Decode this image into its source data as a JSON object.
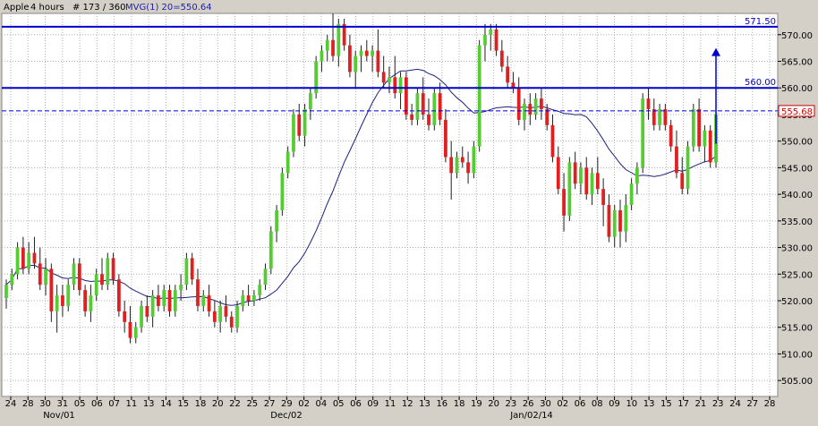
{
  "header": {
    "symbol": "Apple",
    "timeframe": "4 hours",
    "bar_info": "# 173 / 360",
    "indicator": "MVG(1) 20=550.64"
  },
  "colors": {
    "background": "#ffffff",
    "frame": "#d4d0c8",
    "grid": "#b0b0b0",
    "up_candle": "#55cc33",
    "down_candle": "#e02020",
    "wick": "#202020",
    "moving_average": "#1a237e",
    "resistance_line": "#0000cc",
    "price_marker": "#cc0000",
    "header_text": "#000000",
    "indicator_text": "#2020aa"
  },
  "chart_data": {
    "type": "candlestick",
    "ylim": [
      502,
      574
    ],
    "y_ticks": [
      505,
      510,
      515,
      520,
      525,
      530,
      535,
      540,
      545,
      550,
      555,
      560,
      565,
      570
    ],
    "y_tick_labels": [
      "505.00",
      "510.00",
      "515.00",
      "520.00",
      "525.00",
      "530.00",
      "535.00",
      "540.00",
      "545.00",
      "550.00",
      "555.00",
      "560.00",
      "565.00",
      "570.00"
    ],
    "x_tick_labels": [
      "24",
      "28",
      "30",
      "31",
      "05",
      "06",
      "07",
      "11",
      "13",
      "14",
      "15",
      "18",
      "20",
      "22",
      "25",
      "27",
      "29",
      "02",
      "04",
      "05",
      "06",
      "09",
      "11",
      "12",
      "13",
      "16",
      "18",
      "19",
      "20",
      "23",
      "26",
      "30",
      "02",
      "06",
      "08",
      "09",
      "10",
      "13",
      "15",
      "17",
      "21",
      "23",
      "24",
      "27",
      "28"
    ],
    "x_month_labels": [
      "Nov/01",
      "Dec/02",
      "Jan/02/14"
    ],
    "horizontal_lines": [
      {
        "label": "571.50",
        "value": 571.5
      },
      {
        "label": "560.00",
        "value": 560.0
      }
    ],
    "current_price": {
      "label": "555.68",
      "value": 555.68
    },
    "moving_average_label": "MVG(1) 20=550.64",
    "target_arrow": {
      "from": 549.5,
      "to": 567.5
    },
    "ohlc": [
      [
        520.5,
        524,
        518.5,
        523
      ],
      [
        523,
        526,
        522,
        525
      ],
      [
        525,
        531,
        524,
        530
      ],
      [
        530,
        532,
        525,
        526
      ],
      [
        526,
        531,
        525,
        529
      ],
      [
        529,
        532,
        526,
        527
      ],
      [
        527,
        530,
        522,
        523
      ],
      [
        523,
        528,
        521,
        526
      ],
      [
        526,
        527,
        516,
        518
      ],
      [
        518,
        523,
        514,
        521
      ],
      [
        521,
        523,
        517,
        519
      ],
      [
        519,
        524,
        518,
        523
      ],
      [
        523,
        528,
        522,
        527
      ],
      [
        527,
        528,
        521,
        522
      ],
      [
        522,
        523,
        517,
        518
      ],
      [
        518,
        523,
        516,
        521
      ],
      [
        521,
        526,
        520,
        525
      ],
      [
        525,
        528,
        522,
        523
      ],
      [
        523,
        529,
        522,
        528
      ],
      [
        528,
        529,
        523,
        524
      ],
      [
        524,
        525,
        517,
        518
      ],
      [
        518,
        520,
        514,
        516
      ],
      [
        516,
        519,
        512,
        513
      ],
      [
        513,
        516,
        512,
        515
      ],
      [
        515,
        520,
        514,
        519
      ],
      [
        519,
        521,
        516,
        517
      ],
      [
        517,
        522,
        515,
        521
      ],
      [
        521,
        523,
        518,
        519
      ],
      [
        519,
        523,
        518,
        522
      ],
      [
        522,
        523,
        517,
        518
      ],
      [
        518,
        523,
        517,
        522
      ],
      [
        522,
        525,
        520,
        523
      ],
      [
        523,
        529,
        522,
        528
      ],
      [
        528,
        529,
        523,
        524
      ],
      [
        524,
        526,
        518,
        519
      ],
      [
        519,
        522,
        518,
        521
      ],
      [
        521,
        523,
        517,
        518
      ],
      [
        518,
        520,
        515,
        516
      ],
      [
        516,
        520,
        514,
        519
      ],
      [
        519,
        521,
        516,
        517
      ],
      [
        517,
        518,
        514,
        515
      ],
      [
        515,
        520,
        514,
        519
      ],
      [
        519,
        522,
        518,
        521
      ],
      [
        521,
        523,
        519,
        520
      ],
      [
        520,
        522,
        519,
        521
      ],
      [
        521,
        524,
        520,
        523
      ],
      [
        523,
        527,
        522,
        526
      ],
      [
        526,
        534,
        525,
        533
      ],
      [
        533,
        538,
        531,
        537
      ],
      [
        537,
        545,
        536,
        544
      ],
      [
        544,
        549,
        543,
        548
      ],
      [
        548,
        556,
        547,
        555
      ],
      [
        555,
        557,
        550,
        551
      ],
      [
        551,
        557,
        549,
        556
      ],
      [
        556,
        560,
        554,
        559
      ],
      [
        559,
        566,
        558,
        565
      ],
      [
        565,
        568,
        563,
        567
      ],
      [
        567,
        570,
        565,
        569
      ],
      [
        569,
        574,
        565,
        566
      ],
      [
        566,
        573,
        564,
        572
      ],
      [
        572,
        573,
        567,
        568
      ],
      [
        568,
        570,
        562,
        563
      ],
      [
        563,
        567,
        560,
        566
      ],
      [
        566,
        568,
        563,
        567
      ],
      [
        567,
        569,
        565,
        566
      ],
      [
        566,
        568,
        563,
        567
      ],
      [
        567,
        571,
        562,
        563
      ],
      [
        563,
        566,
        560,
        561
      ],
      [
        561,
        564,
        559,
        562
      ],
      [
        562,
        566,
        558,
        559
      ],
      [
        559,
        563,
        556,
        562
      ],
      [
        562,
        563,
        554,
        555
      ],
      [
        555,
        557,
        553,
        554
      ],
      [
        554,
        560,
        553,
        559
      ],
      [
        559,
        562,
        554,
        555
      ],
      [
        555,
        558,
        552,
        553
      ],
      [
        553,
        560,
        552,
        559
      ],
      [
        559,
        561,
        553,
        554
      ],
      [
        554,
        556,
        546,
        547
      ],
      [
        547,
        550,
        539,
        544
      ],
      [
        544,
        548,
        543,
        547
      ],
      [
        547,
        549,
        545,
        546
      ],
      [
        546,
        548,
        542,
        544
      ],
      [
        544,
        550,
        543,
        549
      ],
      [
        549,
        569,
        548,
        568
      ],
      [
        568,
        572,
        565,
        570
      ],
      [
        570,
        572,
        567,
        571
      ],
      [
        571,
        572,
        566,
        567
      ],
      [
        567,
        569,
        563,
        564
      ],
      [
        564,
        566,
        560,
        561
      ],
      [
        561,
        563,
        559,
        560
      ],
      [
        560,
        562,
        553,
        554
      ],
      [
        554,
        558,
        552,
        557
      ],
      [
        557,
        559,
        553,
        555
      ],
      [
        555,
        559,
        554,
        558
      ],
      [
        558,
        560,
        554,
        556
      ],
      [
        556,
        557,
        552,
        553
      ],
      [
        553,
        555,
        546,
        547
      ],
      [
        547,
        549,
        540,
        541
      ],
      [
        541,
        544,
        533,
        536
      ],
      [
        536,
        547,
        535,
        546
      ],
      [
        546,
        548,
        541,
        542
      ],
      [
        542,
        546,
        540,
        545
      ],
      [
        545,
        547,
        539,
        540
      ],
      [
        540,
        545,
        538,
        544
      ],
      [
        544,
        547,
        540,
        541
      ],
      [
        541,
        543,
        534,
        538
      ],
      [
        538,
        540,
        531,
        532
      ],
      [
        532,
        538,
        530,
        537
      ],
      [
        537,
        539,
        530,
        533
      ],
      [
        533,
        540,
        531,
        538
      ],
      [
        538,
        543,
        537,
        542
      ],
      [
        542,
        546,
        540,
        545
      ],
      [
        545,
        559,
        544,
        558
      ],
      [
        558,
        560,
        554,
        556
      ],
      [
        556,
        558,
        552,
        553
      ],
      [
        553,
        557,
        552,
        556
      ],
      [
        556,
        557,
        552,
        553
      ],
      [
        553,
        554,
        548,
        549
      ],
      [
        549,
        552,
        543,
        544
      ],
      [
        544,
        547,
        540,
        541
      ],
      [
        541,
        550,
        540,
        549
      ],
      [
        549,
        557,
        548,
        556
      ],
      [
        556,
        558,
        548,
        549
      ],
      [
        549,
        553,
        546,
        552
      ],
      [
        552,
        553,
        545,
        546
      ],
      [
        546,
        556,
        545,
        555
      ]
    ]
  }
}
